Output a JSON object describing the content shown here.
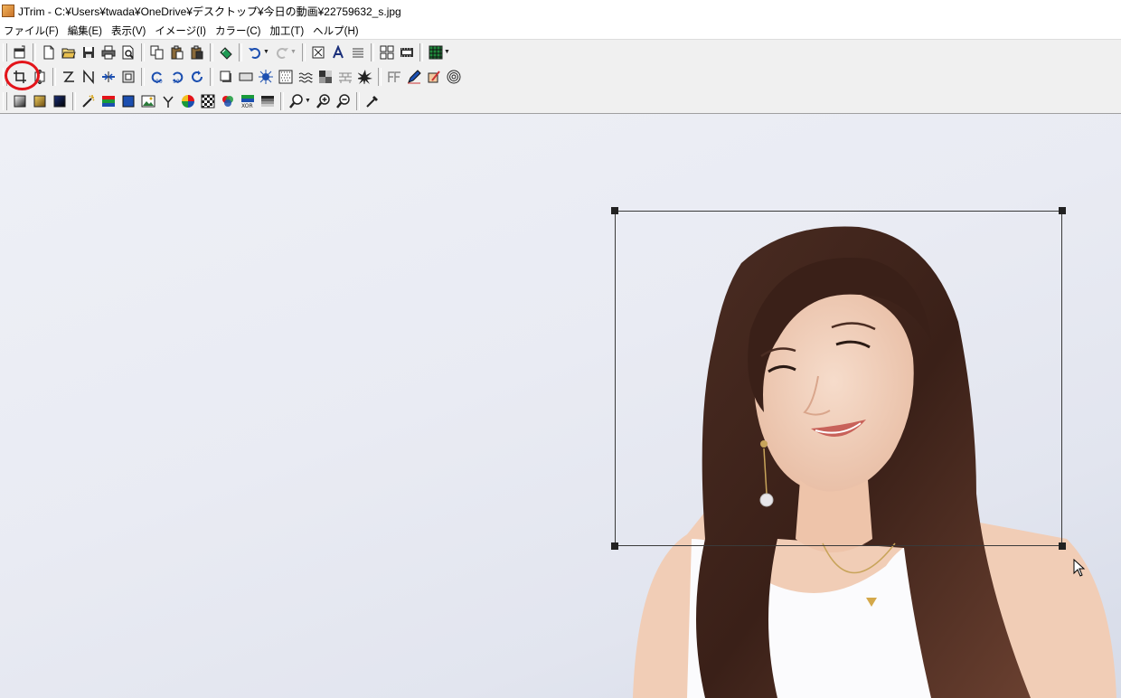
{
  "window": {
    "title": "JTrim - C:¥Users¥twada¥OneDrive¥デスクトップ¥今日の動画¥22759632_s.jpg"
  },
  "menu": [
    {
      "label": "ファイル(F)"
    },
    {
      "label": "編集(E)"
    },
    {
      "label": "表示(V)"
    },
    {
      "label": "イメージ(I)"
    },
    {
      "label": "カラー(C)"
    },
    {
      "label": "加工(T)"
    },
    {
      "label": "ヘルプ(H)"
    }
  ],
  "colors": {
    "accent_highlight": "#e3141a",
    "toolbar_bg": "#f0f0f0",
    "canvas_bg": "#e9ebf3",
    "selection_border": "#3a3a3a"
  },
  "toolbar": {
    "row1_icons": [
      "window-icon",
      "new-file-icon",
      "open-folder-icon",
      "save-icon",
      "print-icon",
      "print-preview-icon",
      "copy-icon",
      "paste-icon",
      "paste-new-icon",
      "capture-icon",
      "undo-icon",
      "redo-icon",
      "fit-window-icon",
      "text-icon",
      "align-icon",
      "tile-icon",
      "film-icon",
      "grid-icon"
    ],
    "row2_icons": [
      "crop-icon",
      "resize-icon",
      "flip-horizontal-icon",
      "flip-vertical-icon",
      "mirror-icon",
      "frame-icon",
      "rotate-left-90-icon",
      "rotate-right-90-icon",
      "rotate-free-icon",
      "shadow-icon",
      "rectangle-icon",
      "sparkle-icon",
      "noise-icon",
      "wave-icon",
      "mosaic-icon",
      "brick-icon",
      "explosion-icon",
      "emboss-icon",
      "pen-icon",
      "eraser-icon",
      "spiral-icon"
    ],
    "row3_icons": [
      "gradient-gray-icon",
      "gradient-gold-icon",
      "gradient-blue-icon",
      "magic-wand-icon",
      "rgb-balance-icon",
      "blue-fill-icon",
      "image-icon",
      "gamma-icon",
      "color-wheel-icon",
      "checker-icon",
      "rgb-circles-icon",
      "xor-icon",
      "palette-icon",
      "zoom-dropdown-icon",
      "zoom-in-icon",
      "zoom-out-icon",
      "eyedropper-icon"
    ]
  }
}
